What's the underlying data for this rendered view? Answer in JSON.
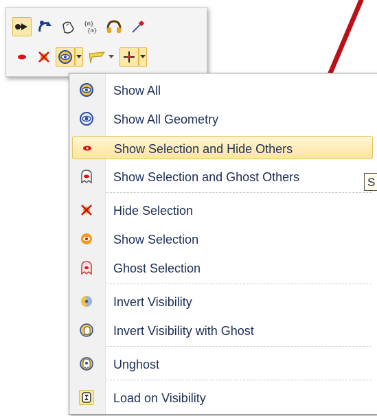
{
  "toolbar": {
    "row1": [
      "select-forward-icon",
      "orbit-icon",
      "hand-pan-icon",
      "macro-icon",
      "headset-icon",
      "eyedropper-icon"
    ],
    "row2": [
      "red-eye-icon",
      "hide-x-icon",
      "show-all-eye-icon",
      "dropdown-arrow",
      "flag-icon",
      "dropdown-arrow",
      "crosshair-icon",
      "dropdown-arrow"
    ]
  },
  "menu": {
    "items": [
      {
        "label": "Show All",
        "icon": "eye-icon"
      },
      {
        "label": "Show All Geometry",
        "icon": "eye-blue-icon"
      },
      {
        "label": "Show Selection and Hide Others",
        "icon": "red-dot-eye-icon"
      },
      {
        "label": "Show Selection and Ghost Others",
        "icon": "ghost-red-icon"
      },
      {
        "label": "Hide Selection",
        "icon": "cross-eye-icon"
      },
      {
        "label": "Show Selection",
        "icon": "orange-eye-icon"
      },
      {
        "label": "Ghost Selection",
        "icon": "ghost-pink-icon"
      },
      {
        "label": "Invert Visibility",
        "icon": "half-eye-icon"
      },
      {
        "label": "Invert Visibility with Ghost",
        "icon": "half-ghost-icon"
      },
      {
        "label": "Unghost",
        "icon": "unghost-icon"
      },
      {
        "label": "Load on Visibility",
        "icon": "hourglass-icon"
      }
    ]
  },
  "tooltip": {
    "text": "S"
  },
  "colors": {
    "accent": "#c10f18",
    "highlight": "#fde59c"
  }
}
